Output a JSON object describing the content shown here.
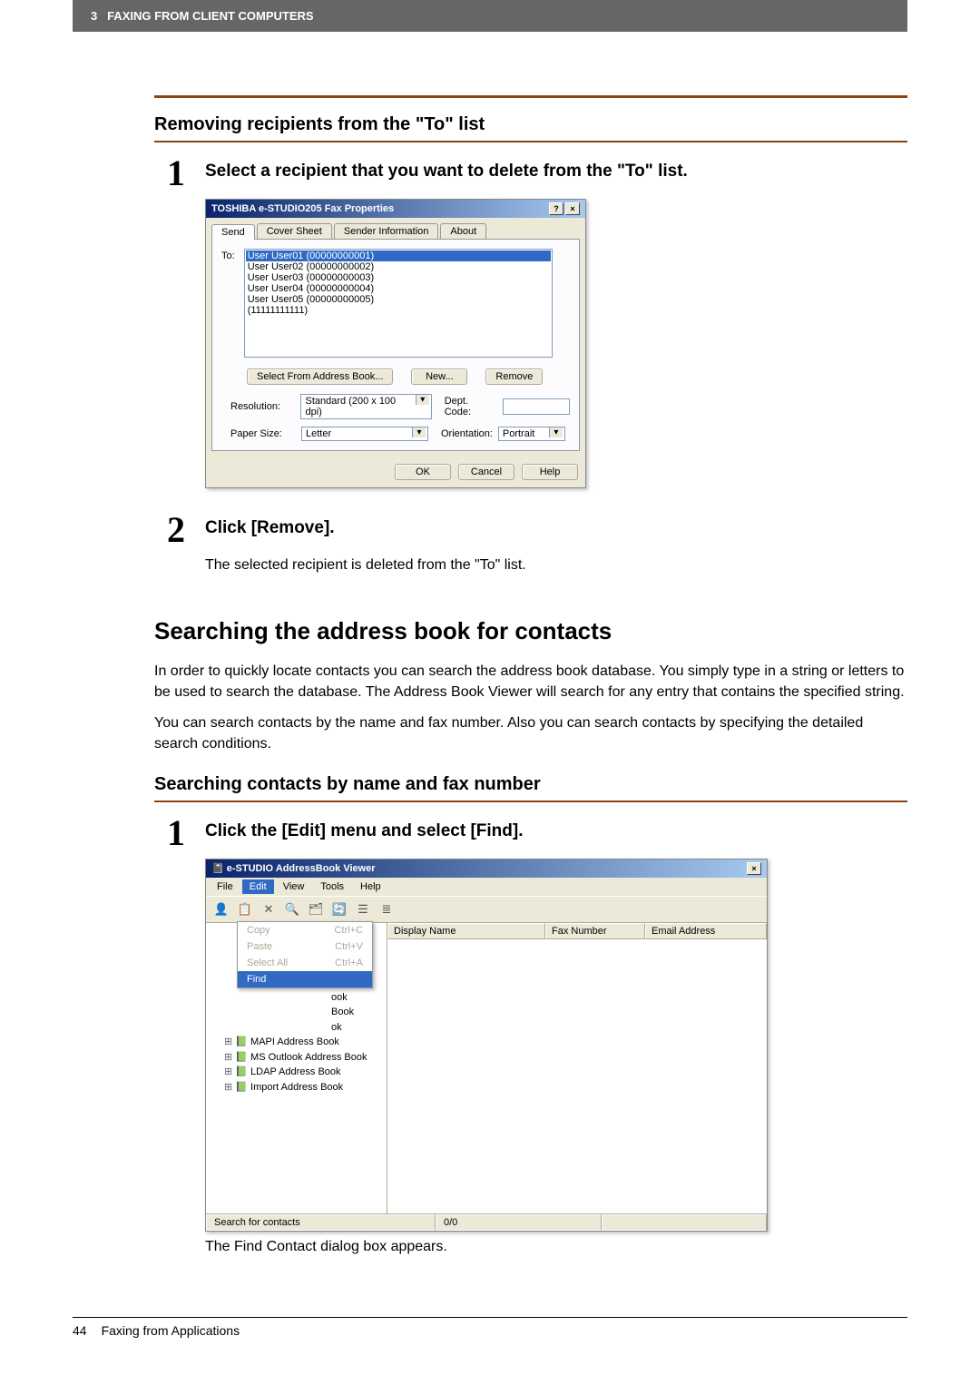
{
  "header": {
    "chapter_num": "3",
    "chapter_title": "FAXING FROM CLIENT COMPUTERS"
  },
  "s1": {
    "heading": "Removing recipients from the \"To\" list",
    "step1": {
      "num": "1",
      "title": "Select a recipient that you want to delete from the \"To\" list."
    },
    "dialog": {
      "title": "TOSHIBA e-STUDIO205 Fax Properties",
      "help": "?",
      "close": "×",
      "tabs": {
        "send": "Send",
        "cover": "Cover Sheet",
        "sender": "Sender Information",
        "about": "About"
      },
      "to_label": "To:",
      "items": [
        "User User01 (00000000001)",
        "User User02 (00000000002)",
        "User User03 (00000000003)",
        "User User04 (00000000004)",
        "User User05 (00000000005)",
        "(11111111111)"
      ],
      "btn_select_ab": "Select From Address Book...",
      "btn_new": "New...",
      "btn_remove": "Remove",
      "resolution_label": "Resolution:",
      "resolution_value": "Standard (200 x 100 dpi)",
      "dept_label": "Dept. Code:",
      "paper_label": "Paper Size:",
      "paper_value": "Letter",
      "orient_label": "Orientation:",
      "orient_value": "Portrait",
      "ok": "OK",
      "cancel": "Cancel",
      "help_btn": "Help"
    },
    "step2": {
      "num": "2",
      "title": "Click [Remove].",
      "body": "The selected recipient is deleted from the \"To\" list."
    }
  },
  "s2": {
    "heading": "Searching the address book for contacts",
    "para1": "In order to quickly locate contacts you can search the address book database. You simply type in a string or letters to be used to search the database. The Address Book Viewer will search for any entry that contains the specified string.",
    "para2": "You can search contacts by the name and fax number. Also you can search contacts by specifying the detailed search conditions.",
    "sub_heading": "Searching contacts by name and fax number",
    "step1": {
      "num": "1",
      "title": "Click the [Edit] menu and select [Find]."
    },
    "abv": {
      "title": "e-STUDIO AddressBook Viewer",
      "close": "×",
      "menu": {
        "file": "File",
        "edit": "Edit",
        "view": "View",
        "tools": "Tools",
        "help": "Help"
      },
      "dropdown": {
        "copy": "Copy",
        "copy_sc": "Ctrl+C",
        "paste": "Paste",
        "paste_sc": "Ctrl+V",
        "select_all": "Select All",
        "select_all_sc": "Ctrl+A",
        "find": "Find"
      },
      "tree": {
        "n0_suffix": "ook",
        "n1_suffix": "Book",
        "n2_suffix": "ok",
        "n3": "MAPI Address Book",
        "n4": "MS Outlook Address Book",
        "n5": "LDAP Address Book",
        "n6": "Import Address Book"
      },
      "cols": {
        "display": "Display Name",
        "fax": "Fax Number",
        "email": "Email Address"
      },
      "status_left": "Search for contacts",
      "status_mid": "0/0"
    },
    "caption": "The Find Contact dialog box appears."
  },
  "footer": {
    "page": "44",
    "title": "Faxing from Applications"
  }
}
